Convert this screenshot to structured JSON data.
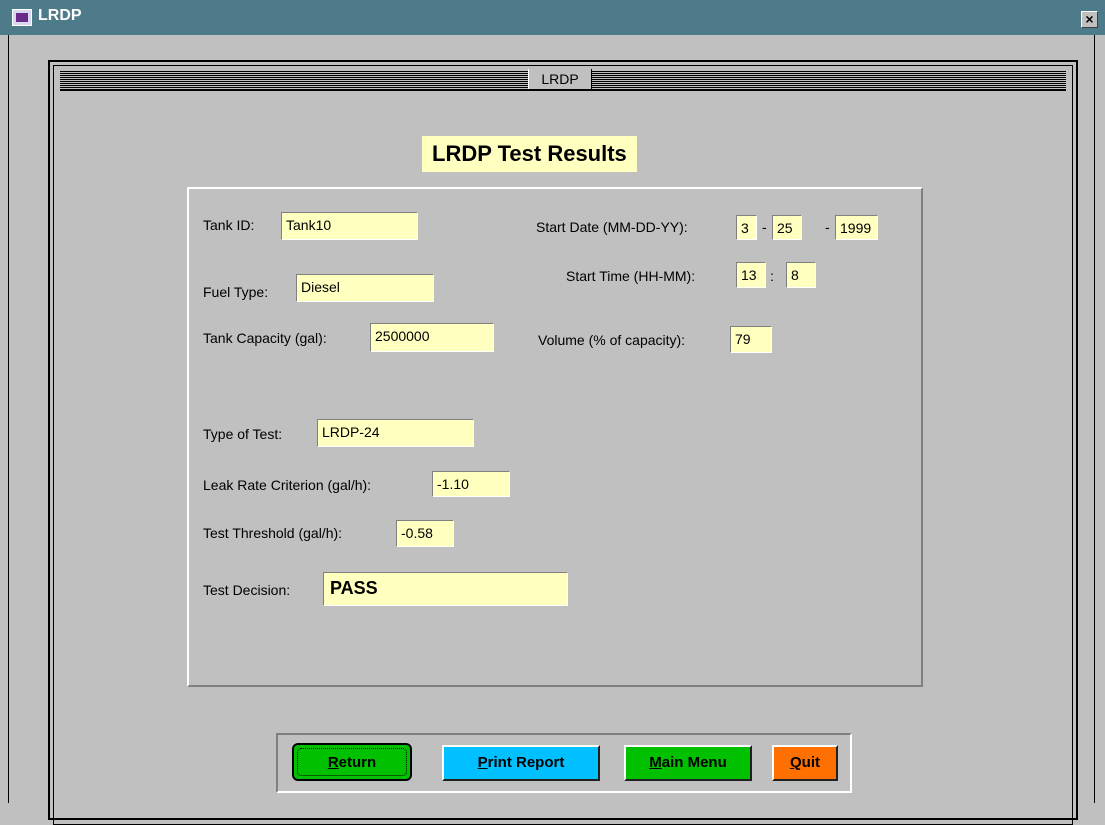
{
  "window": {
    "title": "LRDP",
    "close_glyph": "×"
  },
  "form": {
    "title": "LRDP",
    "heading": "LRDP Test Results"
  },
  "fields": {
    "tank_id": {
      "label": "Tank ID:",
      "value": "Tank10"
    },
    "fuel_type": {
      "label": "Fuel Type:",
      "value": "Diesel"
    },
    "tank_capacity": {
      "label": "Tank Capacity (gal):",
      "value": "2500000"
    },
    "start_date": {
      "label": "Start Date (MM-DD-YY):",
      "month": "3",
      "day": "25",
      "year": "1999",
      "separator": "-"
    },
    "start_time": {
      "label": "Start Time (HH-MM):",
      "hour": "13",
      "minute": "8",
      "separator": ":"
    },
    "volume": {
      "label": "Volume (% of capacity):",
      "value": "79"
    },
    "test_type": {
      "label": "Type of Test:",
      "value": "LRDP-24"
    },
    "leak_rate": {
      "label": "Leak Rate Criterion (gal/h):",
      "value": "-1.10"
    },
    "threshold": {
      "label": "Test Threshold (gal/h):",
      "value": "-0.58"
    },
    "decision": {
      "label": "Test Decision:",
      "value": "PASS"
    }
  },
  "buttons": {
    "return": {
      "hotkey": "R",
      "rest": "eturn"
    },
    "print": {
      "hotkey": "P",
      "rest": "rint Report"
    },
    "menu": {
      "hotkey": "M",
      "rest": "ain Menu"
    },
    "quit": {
      "hotkey": "Q",
      "rest": "uit"
    }
  },
  "colors": {
    "title_bar": "#4e7b8a",
    "field_bg": "#ffffc0",
    "return": "#00c000",
    "print": "#00c0ff",
    "menu": "#00c000",
    "quit": "#ff7000"
  },
  "icons": [
    "app-icon",
    "close-icon"
  ]
}
